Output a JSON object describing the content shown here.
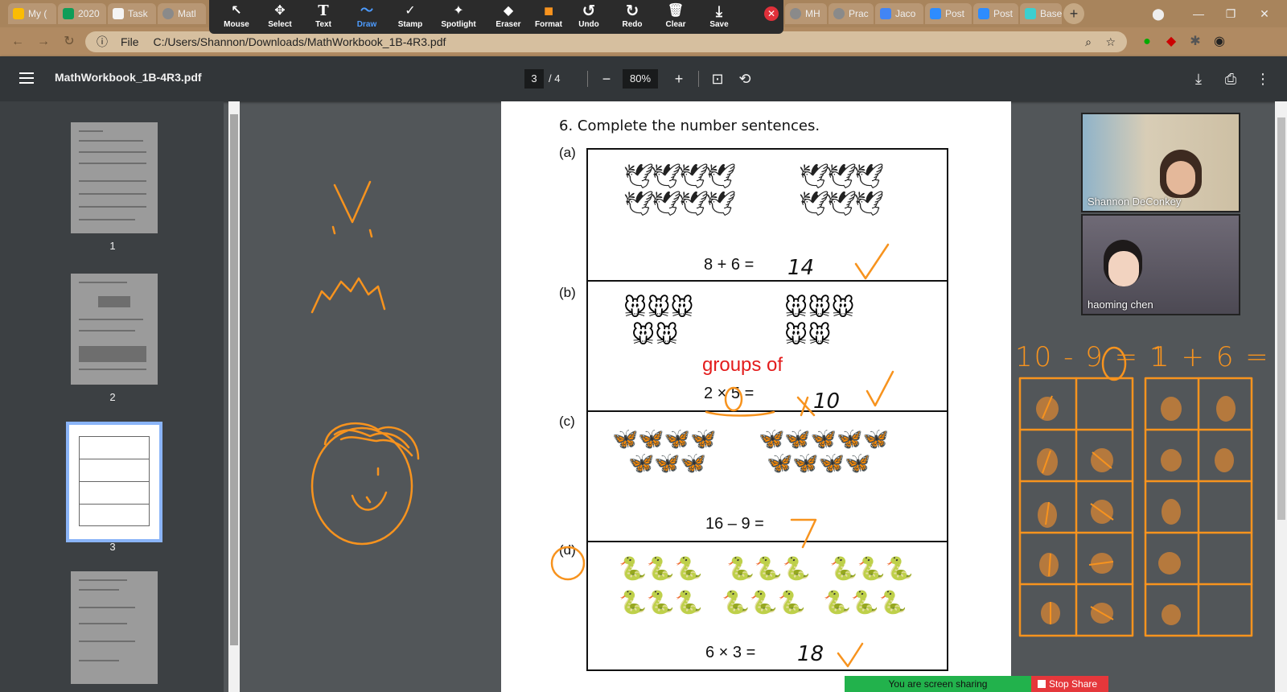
{
  "browser": {
    "tabs": [
      {
        "label": "My (",
        "color": "#fbbc04"
      },
      {
        "label": "2020",
        "color": "#0f9d58"
      },
      {
        "label": "Task",
        "color": "#f4f4f4"
      },
      {
        "label": "Matl",
        "color": "#8a8a8a"
      },
      {
        "label": "MH",
        "color": "#8a8a8a"
      },
      {
        "label": "Prac",
        "color": "#8a8a8a"
      },
      {
        "label": "Jaco",
        "color": "#4285f4"
      },
      {
        "label": "Post",
        "color": "#2d8cff"
      },
      {
        "label": "Post",
        "color": "#2d8cff"
      },
      {
        "label": "Base",
        "color": "#3ccfcf"
      }
    ],
    "url_prefix": "File",
    "url": "C:/Users/Shannon/Downloads/MathWorkbook_1B-4R3.pdf"
  },
  "annotate": {
    "tools": [
      {
        "label": "Mouse",
        "icon": "↖"
      },
      {
        "label": "Select",
        "icon": "✥"
      },
      {
        "label": "Text",
        "icon": "T"
      },
      {
        "label": "Draw",
        "icon": "〜"
      },
      {
        "label": "Stamp",
        "icon": "✓"
      },
      {
        "label": "Spotlight",
        "icon": "✦"
      },
      {
        "label": "Eraser",
        "icon": "◆"
      },
      {
        "label": "Format",
        "icon": "■"
      },
      {
        "label": "Undo",
        "icon": "↺"
      },
      {
        "label": "Redo",
        "icon": "↻"
      },
      {
        "label": "Clear",
        "icon": "🗑"
      },
      {
        "label": "Save",
        "icon": "⤓"
      }
    ],
    "active_tool": "Draw",
    "format_color": "#f7931e"
  },
  "pdf": {
    "title": "MathWorkbook_1B-4R3.pdf",
    "current_page": "3",
    "total_pages": "/ 4",
    "zoom": "80%",
    "thumbnails": [
      "1",
      "2",
      "3"
    ]
  },
  "worksheet": {
    "question": "6.  Complete the number sentences.",
    "parts": [
      {
        "label": "(a)",
        "equation": "8  +  6  =",
        "answer": "14"
      },
      {
        "label": "(b)",
        "equation": "2  ×  5  =",
        "answer": "10"
      },
      {
        "label": "(c)",
        "equation": "16  –  9  =",
        "answer": "7"
      },
      {
        "label": "(d)",
        "equation": "6  ×  3  =",
        "answer": "18"
      }
    ],
    "typed_note": "groups of"
  },
  "participants": [
    {
      "name": "Shannon DeConkey"
    },
    {
      "name": "haoming chen"
    }
  ],
  "whiteboard": {
    "eq1": "10 - 9 = 1",
    "eq2": "1 + 6 ="
  },
  "share": {
    "status": "You are screen sharing",
    "stop": "Stop Share"
  }
}
